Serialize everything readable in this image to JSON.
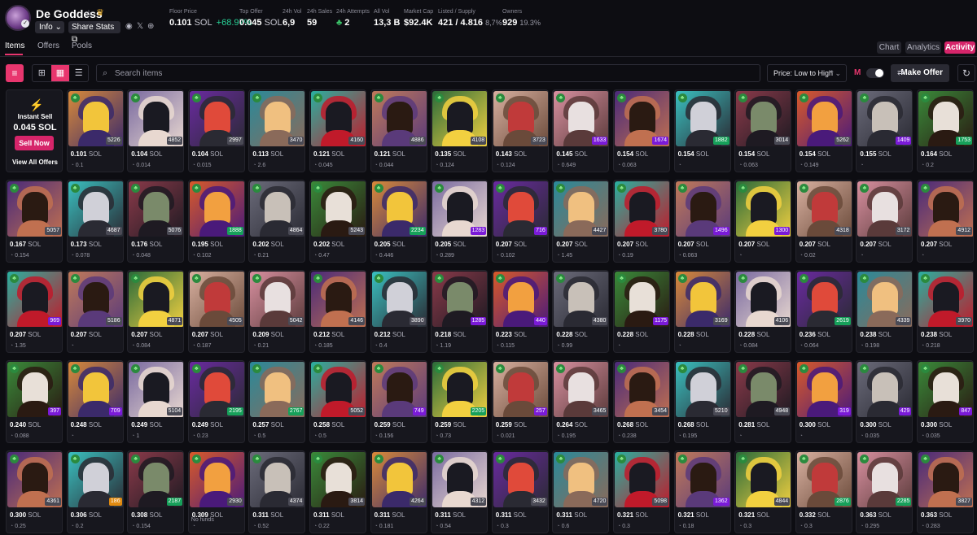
{
  "header": {
    "collection_name": "De Goddess",
    "info_label": "Info",
    "share_label": "Share Stats",
    "stats": [
      {
        "label": "Floor Price",
        "value": "0.101",
        "unit": "SOL",
        "change": "+68.97%"
      },
      {
        "label": "Top Offer",
        "value": "0.045",
        "unit": "SOL"
      },
      {
        "label": "24h Vol",
        "value": "6,9"
      },
      {
        "label": "24h Sales",
        "value": "59"
      },
      {
        "label": "24h Attempts",
        "value": "2"
      },
      {
        "label": "All Vol",
        "value": "13,3 B"
      },
      {
        "label": "Market Cap",
        "value": "$92.4K"
      },
      {
        "label": "Listed / Supply",
        "value": "421 / 4.816",
        "sub": "8,7%"
      },
      {
        "label": "Owners",
        "value": "929",
        "sub": "19.3%"
      }
    ]
  },
  "tabs": {
    "items": "Items",
    "offers": "Offers",
    "pools": "Pools"
  },
  "right_tabs": {
    "chart": "Chart",
    "analytics": "Analytics",
    "activity": "Activity"
  },
  "toolbar": {
    "search_placeholder": "Search items",
    "sort_label": "Price: Low to High",
    "make_offer_label": "Make Offer"
  },
  "instant_sell": {
    "label": "Instant Sell",
    "price": "0.045 SOL",
    "sell_now": "Sell Now",
    "view_all": "View All Offers"
  },
  "no_funds": "No funds",
  "items": [
    {
      "price": "0.101",
      "rank": "5226",
      "last": "0.1"
    },
    {
      "price": "0.104",
      "rank": "4852",
      "last": "0.014"
    },
    {
      "price": "0.104",
      "rank": "2997",
      "last": "0.015"
    },
    {
      "price": "0.113",
      "rank": "3470",
      "last": "2.6"
    },
    {
      "price": "0.121",
      "rank": "4160",
      "last": "0.045"
    },
    {
      "price": "0.121",
      "rank": "4886",
      "last": "0.044"
    },
    {
      "price": "0.135",
      "rank": "4108",
      "last": "0.124"
    },
    {
      "price": "0.143",
      "rank": "3723",
      "last": "0.124"
    },
    {
      "price": "0.145",
      "rank": "1633",
      "last": "0.649"
    },
    {
      "price": "0.154",
      "rank": "1674",
      "last": "0.063"
    },
    {
      "price": "0.154",
      "rank": "1882",
      "last": ""
    },
    {
      "price": "0.154",
      "rank": "3014",
      "last": "0.063"
    },
    {
      "price": "0.154",
      "rank": "5262",
      "last": "0.149"
    },
    {
      "price": "0.155",
      "rank": "1409",
      "last": ""
    },
    {
      "price": "0.164",
      "rank": "1753",
      "last": "0.2"
    },
    {
      "price": "0.167",
      "rank": "5057",
      "last": "0.154"
    },
    {
      "price": "0.173",
      "rank": "4687",
      "last": "0.078"
    },
    {
      "price": "0.176",
      "rank": "5076",
      "last": "0.048"
    },
    {
      "price": "0.195",
      "rank": "1888",
      "last": "0.102"
    },
    {
      "price": "0.202",
      "rank": "4864",
      "last": "0.21"
    },
    {
      "price": "0.202",
      "rank": "5243",
      "last": "0.47"
    },
    {
      "price": "0.205",
      "rank": "2234",
      "last": "0.446"
    },
    {
      "price": "0.205",
      "rank": "1283",
      "last": "0.289"
    },
    {
      "price": "0.207",
      "rank": "716",
      "last": "0.102"
    },
    {
      "price": "0.207",
      "rank": "4427",
      "last": "1.45"
    },
    {
      "price": "0.207",
      "rank": "3780",
      "last": "0.19"
    },
    {
      "price": "0.207",
      "rank": "1496",
      "last": "0.063"
    },
    {
      "price": "0.207",
      "rank": "1300",
      "last": ""
    },
    {
      "price": "0.207",
      "rank": "4318",
      "last": "0.02"
    },
    {
      "price": "0.207",
      "rank": "3172",
      "last": ""
    },
    {
      "price": "0.207",
      "rank": "4912",
      "last": ""
    },
    {
      "price": "0.207",
      "rank": "969",
      "last": "1.35"
    },
    {
      "price": "0.207",
      "rank": "5186",
      "last": ""
    },
    {
      "price": "0.207",
      "rank": "4871",
      "last": "0.084"
    },
    {
      "price": "0.207",
      "rank": "4505",
      "last": "0.187"
    },
    {
      "price": "0.209",
      "rank": "5042",
      "last": "0.21"
    },
    {
      "price": "0.212",
      "rank": "4146",
      "last": "0.185"
    },
    {
      "price": "0.212",
      "rank": "3890",
      "last": "0.4"
    },
    {
      "price": "0.218",
      "rank": "1285",
      "last": "1.19"
    },
    {
      "price": "0.223",
      "rank": "440",
      "last": "0.115"
    },
    {
      "price": "0.228",
      "rank": "4380",
      "last": "0.99"
    },
    {
      "price": "0.228",
      "rank": "1175",
      "last": ""
    },
    {
      "price": "0.228",
      "rank": "3169",
      "last": ""
    },
    {
      "price": "0.228",
      "rank": "4106",
      "last": "0.084"
    },
    {
      "price": "0.236",
      "rank": "2619",
      "last": "0.064"
    },
    {
      "price": "0.238",
      "rank": "4339",
      "last": "0.198"
    },
    {
      "price": "0.238",
      "rank": "3970",
      "last": "0.218"
    },
    {
      "price": "0.240",
      "rank": "397",
      "last": "0.088"
    },
    {
      "price": "0.248",
      "rank": "709",
      "last": ""
    },
    {
      "price": "0.249",
      "rank": "5104",
      "last": "1"
    },
    {
      "price": "0.249",
      "rank": "2195",
      "last": "0.23"
    },
    {
      "price": "0.257",
      "rank": "2767",
      "last": "0.5"
    },
    {
      "price": "0.258",
      "rank": "5052",
      "last": "0.5"
    },
    {
      "price": "0.259",
      "rank": "749",
      "last": "0.156"
    },
    {
      "price": "0.259",
      "rank": "2205",
      "last": "0.73"
    },
    {
      "price": "0.259",
      "rank": "257",
      "last": "0.021"
    },
    {
      "price": "0.264",
      "rank": "3465",
      "last": "0.195"
    },
    {
      "price": "0.268",
      "rank": "3454",
      "last": "0.238"
    },
    {
      "price": "0.268",
      "rank": "5210",
      "last": "0.195"
    },
    {
      "price": "0.281",
      "rank": "4948",
      "last": ""
    },
    {
      "price": "0.300",
      "rank": "319",
      "last": ""
    },
    {
      "price": "0.300",
      "rank": "429",
      "last": "0.035"
    },
    {
      "price": "0.300",
      "rank": "847",
      "last": "0.035"
    },
    {
      "price": "0.300",
      "rank": "4361",
      "last": "0.25"
    },
    {
      "price": "0.306",
      "rank": "186",
      "last": "0.2"
    },
    {
      "price": "0.308",
      "rank": "2187",
      "last": "0.154"
    },
    {
      "price": "0.309",
      "rank": "2930",
      "last": ""
    },
    {
      "price": "0.311",
      "rank": "4374",
      "last": "0.52"
    },
    {
      "price": "0.311",
      "rank": "3814",
      "last": "0.22"
    },
    {
      "price": "0.311",
      "rank": "4264",
      "last": "0.181"
    },
    {
      "price": "0.311",
      "rank": "4312",
      "last": "0.54"
    },
    {
      "price": "0.311",
      "rank": "3432",
      "last": "0.3"
    },
    {
      "price": "0.311",
      "rank": "4720",
      "last": "0.6"
    },
    {
      "price": "0.321",
      "rank": "5098",
      "last": "0.3"
    },
    {
      "price": "0.321",
      "rank": "1362",
      "last": "0.18"
    },
    {
      "price": "0.321",
      "rank": "4844",
      "last": "0.3"
    },
    {
      "price": "0.332",
      "rank": "2876",
      "last": "0.3"
    },
    {
      "price": "0.363",
      "rank": "2285",
      "last": "0.295"
    },
    {
      "price": "0.363",
      "rank": "3827",
      "last": "0.283"
    }
  ]
}
